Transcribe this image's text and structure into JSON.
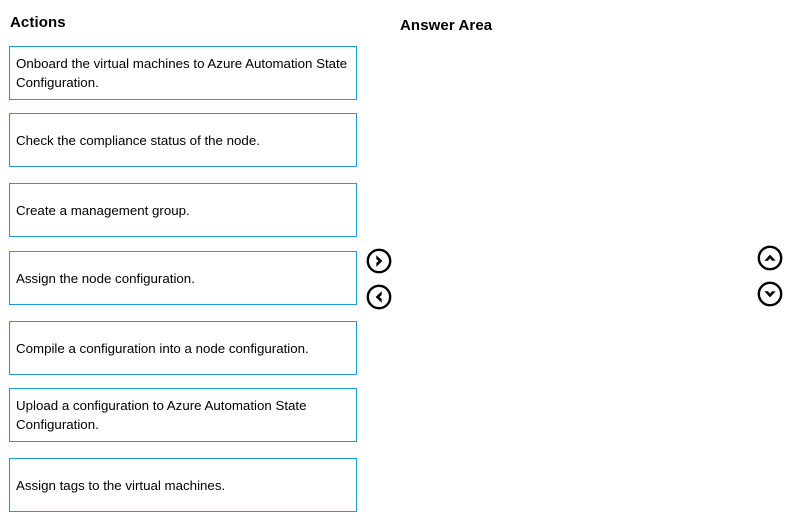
{
  "columns": {
    "actions_heading": "Actions",
    "answer_area_heading": "Answer Area"
  },
  "actions": {
    "items": [
      {
        "text": "Onboard the virtual machines to Azure Automation State Configuration."
      },
      {
        "text": "Check the compliance status of the node."
      },
      {
        "text": "Create a management group."
      },
      {
        "text": "Assign the node configuration."
      },
      {
        "text": "Compile a configuration into a node configuration."
      },
      {
        "text": "Upload a configuration to Azure Automation State Configuration."
      },
      {
        "text": "Assign tags to the virtual machines."
      }
    ]
  },
  "controls": {
    "move_right": {
      "icon": "chevron-right-circle-icon",
      "label": ""
    },
    "move_left": {
      "icon": "chevron-left-circle-icon",
      "label": ""
    },
    "move_up": {
      "icon": "chevron-up-circle-icon",
      "label": ""
    },
    "move_down": {
      "icon": "chevron-down-circle-icon",
      "label": ""
    }
  },
  "answer_area": {
    "items": []
  },
  "colors": {
    "box_border": "#1e9bd7",
    "text": "#000000",
    "background": "#ffffff",
    "icon": "#000000"
  }
}
